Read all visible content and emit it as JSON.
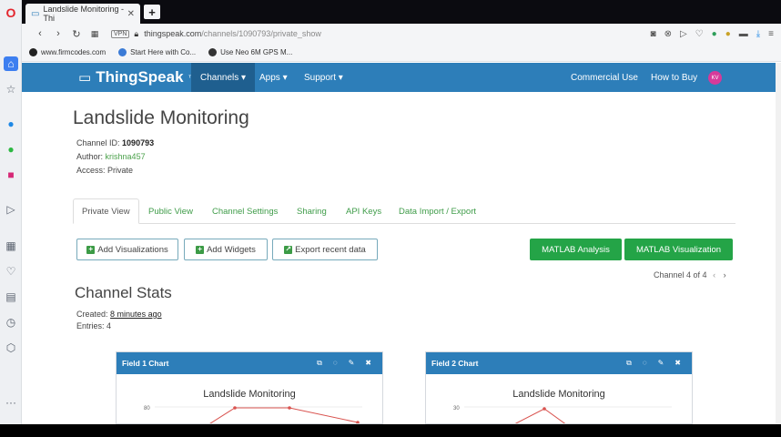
{
  "browser": {
    "tab_title": "Landslide Monitoring - Thi",
    "tab_close": "✕",
    "new_tab": "+",
    "url_host": "thingspeak.com",
    "url_path": "/channels/1090793/private_show",
    "vpn_label": "VPN",
    "bookmarks": [
      {
        "label": "www.firmcodes.com",
        "color": "#222"
      },
      {
        "label": "Start Here with Co...",
        "color": "#3b7bd6"
      },
      {
        "label": "Use Neo 6M GPS M...",
        "color": "#333"
      }
    ]
  },
  "nav": {
    "logo": "ThingSpeak",
    "logo_tm": "™",
    "channels": "Channels ▾",
    "apps": "Apps ▾",
    "support": "Support ▾",
    "commercial": "Commercial Use",
    "how_to_buy": "How to Buy",
    "avatar_initials": "KV"
  },
  "channel": {
    "title": "Landslide Monitoring",
    "id_label": "Channel ID:",
    "id": "1090793",
    "author_label": "Author:",
    "author": "krishna457",
    "access_label": "Access:",
    "access": "Private"
  },
  "tabs": [
    "Private View",
    "Public View",
    "Channel Settings",
    "Sharing",
    "API Keys",
    "Data Import / Export"
  ],
  "buttons": {
    "add_visualizations": "Add Visualizations",
    "add_widgets": "Add Widgets",
    "export": "Export recent data",
    "matlab_analysis": "MATLAB Analysis",
    "matlab_visualization": "MATLAB Visualization"
  },
  "pager": "Channel 4 of 4",
  "stats": {
    "title": "Channel Stats",
    "created_label": "Created:",
    "created_value": "8 minutes ago",
    "entries": "Entries: 4"
  },
  "cards": [
    {
      "title": "Field 1 Chart",
      "chart_title": "Landslide Monitoring",
      "tick": "80"
    },
    {
      "title": "Field 2 Chart",
      "chart_title": "Landslide Monitoring",
      "tick": "30"
    }
  ],
  "colors": {
    "brand": "#2d7eb9",
    "green": "#24a447",
    "link": "#4ba14b",
    "line": "#d9534f"
  }
}
